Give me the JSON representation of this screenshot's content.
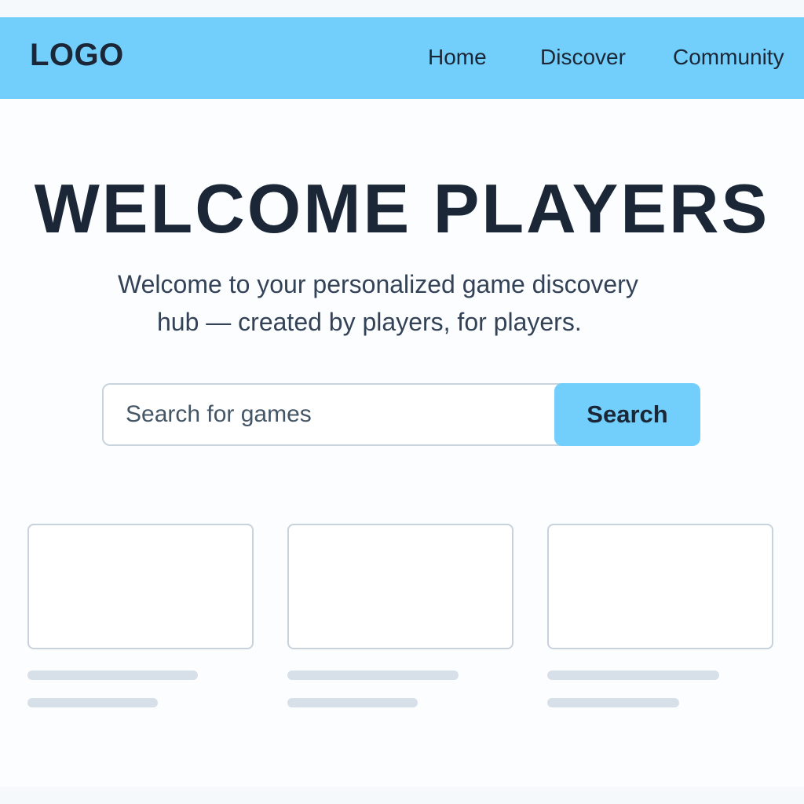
{
  "navbar": {
    "logo": "LOGO",
    "links": [
      {
        "label": "Home"
      },
      {
        "label": "Discover"
      },
      {
        "label": "Community"
      }
    ]
  },
  "hero": {
    "title": "WELCOME PLAYERS",
    "subtitle_line1": "Welcome to your personalized game discovery",
    "subtitle_line2": "hub — created by players, for players."
  },
  "search": {
    "placeholder": "Search for games",
    "value": "",
    "button_label": "Search"
  },
  "colors": {
    "accent": "#72cffc",
    "text_dark": "#1b2736",
    "text_body": "#334256",
    "border": "#c7d2dc",
    "skeleton": "#d7e0e8"
  }
}
